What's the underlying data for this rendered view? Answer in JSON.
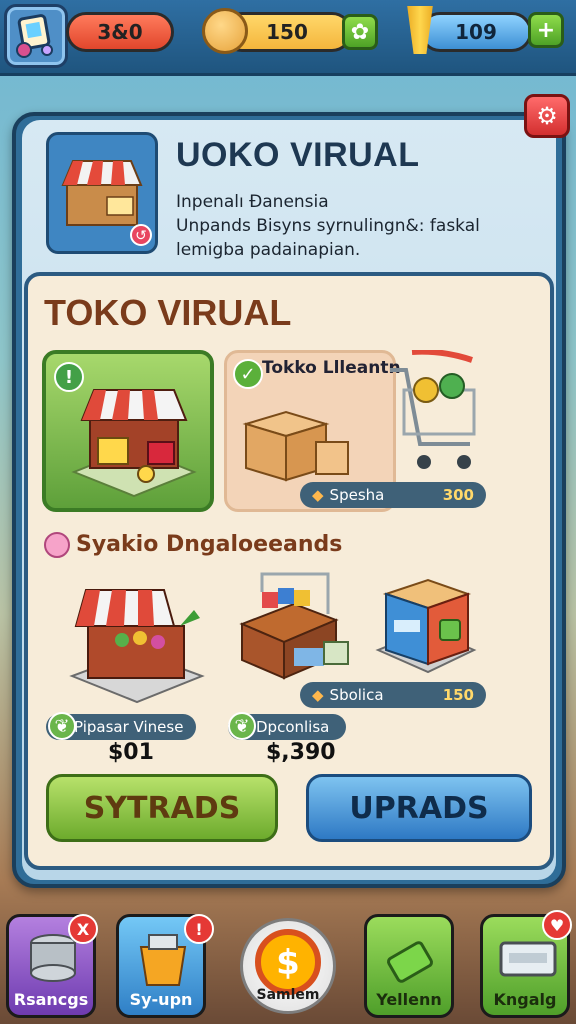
{
  "topbar": {
    "resource1_value": "3&0",
    "resource2_value": "150",
    "resource3_value": "109"
  },
  "panel": {
    "title": "UOKO VIRUAL",
    "subtitle": "Inpenalı Ɖanensia",
    "description": "Unpands Bisyns syrnulingn&: faskal lemigba padainapian."
  },
  "store": {
    "heading": "TOKO VIRUAL",
    "card2_label": "Tokko Llleantn",
    "card2_tag": "Spesha",
    "card2_price": "300",
    "section_title": "Syakio Dngaloeeands",
    "items": [
      {
        "tag": "Pipasar Vinese",
        "price": "$01"
      },
      {
        "tag": "Dpconlisa",
        "price": "$,390"
      },
      {
        "tag": "Sbolica",
        "value": "150"
      }
    ],
    "button_left": "SYTRADS",
    "button_right": "UPRADS"
  },
  "bottom_nav": [
    {
      "label": "Rsancgs",
      "badge": "X"
    },
    {
      "label": "Sy-upn",
      "badge": "!"
    },
    {
      "label": "Samlem"
    },
    {
      "label": "Yellenn"
    },
    {
      "label": "Kngalg",
      "badge": "♥"
    }
  ]
}
